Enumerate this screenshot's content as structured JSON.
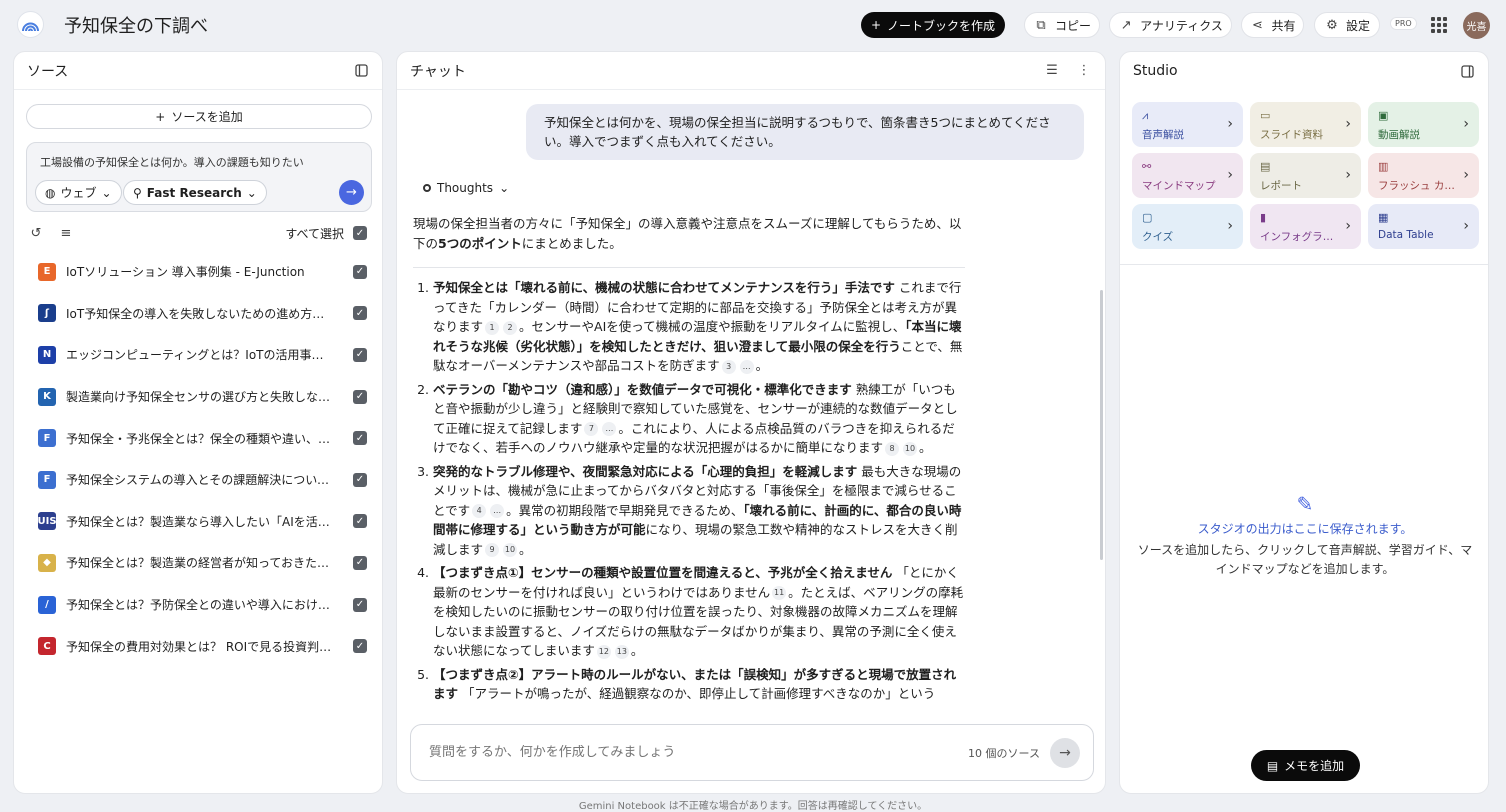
{
  "header": {
    "title": "予知保全の下調べ",
    "create_notebook": "ノートブックを作成",
    "copy": "コピー",
    "analytics": "アナリティクス",
    "share": "共有",
    "settings": "設定",
    "pro_badge": "PRO",
    "avatar_text": "光喜"
  },
  "sources": {
    "title": "ソース",
    "add_label": "ソースを追加",
    "query_text": "工場設備の予知保全とは何か。導入の課題も知りたい",
    "web_chip": "ウェブ",
    "research_chip": "Fast Research",
    "select_all": "すべて選択",
    "items": [
      {
        "label": "IoTソリューション 導入事例集 - E-Junction",
        "icon_color": "#e8672a",
        "icon_text": "E"
      },
      {
        "label": "IoT予知保全の導入を失敗しないための進め方｜...",
        "icon_color": "#1a3e8c",
        "icon_text": "ʃ"
      },
      {
        "label": "エッジコンピューティングとは？IoTの活用事例...",
        "icon_color": "#1d3fa8",
        "icon_text": "N"
      },
      {
        "label": "製造業向け予知保全センサの選び方と失敗しない...",
        "icon_color": "#2364b0",
        "icon_text": "K"
      },
      {
        "label": "予知保全・予兆保全とは？保全の種類や違い、事...",
        "icon_color": "#3c6fd0",
        "icon_text": "F"
      },
      {
        "label": "予知保全システムの導入とその課題解決について ...",
        "icon_color": "#3c6fd0",
        "icon_text": "F"
      },
      {
        "label": "予知保全とは？製造業なら導入したい「AIを活用...",
        "icon_color": "#2c3f8f",
        "icon_text": "UIS"
      },
      {
        "label": "予知保全とは？製造業の経営者が知っておきたい...",
        "icon_color": "#d8b24a",
        "icon_text": "◆"
      },
      {
        "label": "予知保全とは？予防保全との違いや導入における...",
        "icon_color": "#2a63d6",
        "icon_text": "/"
      },
      {
        "label": "予知保全の費用対効果とは？ ROIで見る投資判断...",
        "icon_color": "#c4262e",
        "icon_text": "C"
      }
    ]
  },
  "chat": {
    "title": "チャット",
    "user_message": "予知保全とは何かを、現場の保全担当に説明するつもりで、箇条書き5つにまとめてください。導入でつまずく点も入れてください。",
    "thoughts_label": "Thoughts",
    "intro_a": "現場の保全担当者の方々に「予知保全」の導入意義や注意点をスムーズに理解してもらうため、以下の",
    "intro_b": "5つのポイント",
    "intro_c": "にまとめました。",
    "input_placeholder": "質問をするか、何かを作成してみましょう",
    "source_count": "10 個のソース",
    "cite_1": "1",
    "cite_2": "2",
    "cite_3": "3",
    "cite_7": "7",
    "cite_8": "8",
    "cite_10": "10",
    "cite_4": "4",
    "cite_9": "9",
    "cite_11": "11",
    "cite_12": "12",
    "cite_13": "13",
    "cite_more": "…",
    "items": [
      {
        "b1": "予知保全とは「壊れる前に、機械の状態に合わせてメンテナンスを行う」手法です",
        "t1": " これまで行ってきた「カレンダー（時間）に合わせて定期的に部品を交換する」予防保全とは考え方が異なります",
        "t2": "。センサーやAIを使って機械の温度や振動をリアルタイムに監視し、",
        "b2": "「本当に壊れそうな兆候（劣化状態）」を検知したときだけ、狙い澄まして最小限の保全を行う",
        "t3": "ことで、無駄なオーバーメンテナンスや部品コストを防ぎます",
        "t4": "。"
      },
      {
        "b1": "ベテランの「勘やコツ（違和感）」を数値データで可視化・標準化できます",
        "t1": " 熟練工が「いつもと音や振動が少し違う」と経験則で察知していた感覚を、センサーが連続的な数値データとして正確に捉えて記録します",
        "t2": "。これにより、人による点検品質のバラつきを抑えられるだけでなく、若手へのノウハウ継承や定量的な状況把握がはるかに簡単になります",
        "t3": "。"
      },
      {
        "b1": "突発的なトラブル修理や、夜間緊急対応による「心理的負担」を軽減します",
        "t1": " 最も大きな現場のメリットは、機械が急に止まってからバタバタと対応する「事後保全」を極限まで減らせることです",
        "t2": "。異常の初期段階で早期発見できるため、",
        "b2": "「壊れる前に、計画的に、都合の良い時間帯に修理する」という動き方が可能",
        "t3": "になり、現場の緊急工数や精神的なストレスを大きく削減します",
        "t4": "。"
      },
      {
        "b1": "【つまずき点①】センサーの種類や設置位置を間違えると、予兆が全く拾えません",
        "t1": " 「とにかく最新のセンサーを付ければ良い」というわけではありません",
        "t2": "。たとえば、ベアリングの摩耗を検知したいのに振動センサーの取り付け位置を誤ったり、対象機器の故障メカニズムを理解しないまま設置すると、ノイズだらけの無駄なデータばかりが集まり、異常の予測に全く使えない状態になってしまいます",
        "t3": "。"
      },
      {
        "b1": "【つまずき点②】アラート時のルールがない、または「誤検知」が多すぎると現場で放置されます",
        "t1": " 「アラートが鳴ったが、経過観察なのか、即停止して計画修理すべきなのか」という"
      }
    ]
  },
  "studio": {
    "title": "Studio",
    "tiles": [
      {
        "label": "音声解説",
        "icon": "waveform-icon",
        "bg": "#e8ebf8",
        "color": "#3a4fa0",
        "glyph": "⩘"
      },
      {
        "label": "スライド資料",
        "icon": "slides-icon",
        "bg": "#f1eee4",
        "color": "#7a6f45",
        "glyph": "▭"
      },
      {
        "label": "動画解説",
        "icon": "video-icon",
        "bg": "#e4f1e6",
        "color": "#2f6a3c",
        "glyph": "▣"
      },
      {
        "label": "マインドマップ",
        "icon": "mindmap-icon",
        "bg": "#f1e6f0",
        "color": "#8a3c80",
        "glyph": "⚯"
      },
      {
        "label": "レポート",
        "icon": "report-icon",
        "bg": "#eeede6",
        "color": "#6a6745",
        "glyph": "▤"
      },
      {
        "label": "フラッシュ カード",
        "icon": "flashcard-icon",
        "bg": "#f6e6e6",
        "color": "#9a3e3e",
        "glyph": "▥"
      },
      {
        "label": "クイズ",
        "icon": "quiz-icon",
        "bg": "#e3eef8",
        "color": "#2e5f8f",
        "glyph": "▢"
      },
      {
        "label": "インフォグラフィック",
        "icon": "infographic-icon",
        "bg": "#f0e6f2",
        "color": "#7a3c8a",
        "glyph": "▮"
      },
      {
        "label": "Data Table",
        "icon": "table-icon",
        "bg": "#e7eaf7",
        "color": "#2f3f8f",
        "glyph": "▦"
      }
    ],
    "empty_title": "スタジオの出力はここに保存されます。",
    "empty_desc": "ソースを追加したら、クリックして音声解説、学習ガイド、マインドマップなどを追加します。",
    "memo_button": "メモを追加"
  },
  "footer": {
    "disclaimer": "Gemini Notebook は不正確な場合があります。回答は再確認してください。"
  }
}
